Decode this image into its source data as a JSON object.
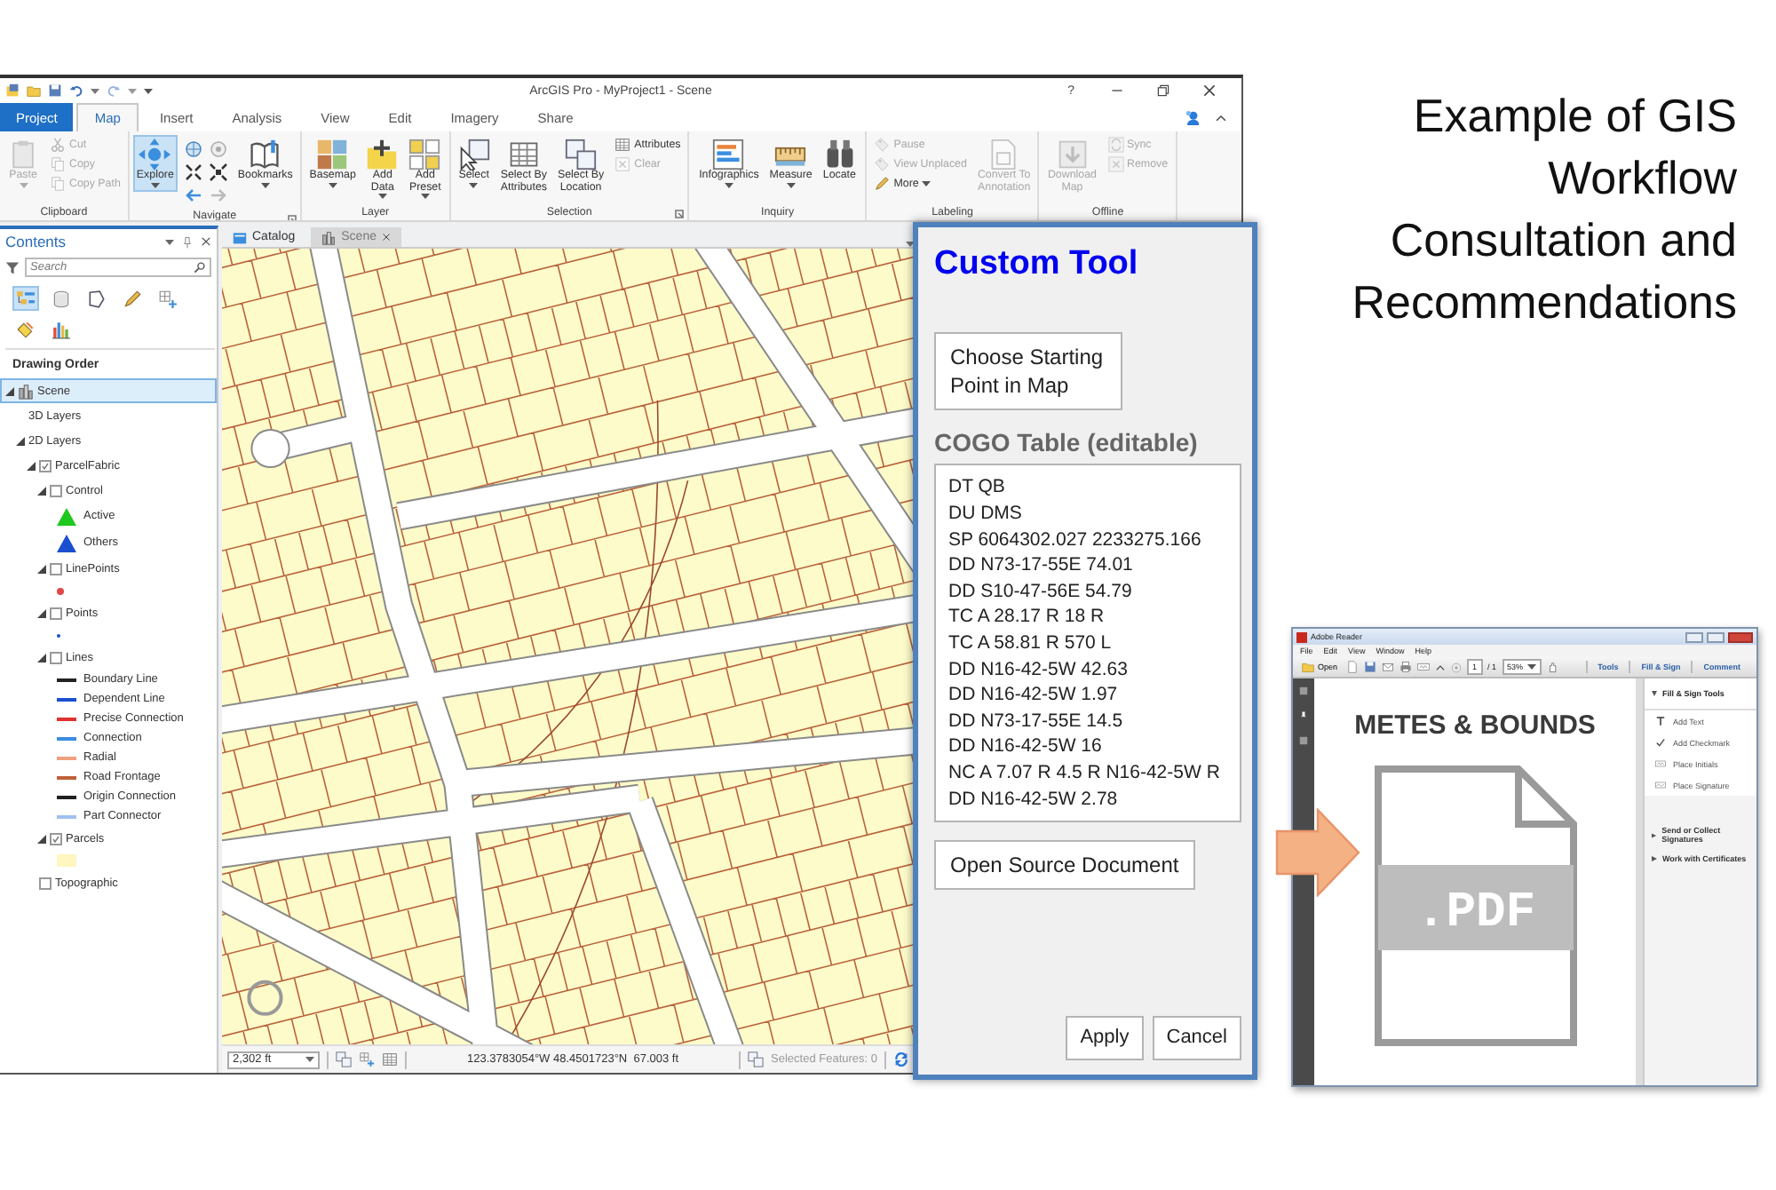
{
  "slide": {
    "title": "Example of GIS Workflow Consultation and Recommendations"
  },
  "arcgis": {
    "title": "ArcGIS Pro - MyProject1 - Scene",
    "help": "?",
    "tabs": [
      {
        "label": "Project",
        "kind": "backstage",
        "selected": false
      },
      {
        "label": "Map",
        "kind": "tab",
        "selected": true
      },
      {
        "label": "Insert",
        "kind": "tab",
        "selected": false
      },
      {
        "label": "Analysis",
        "kind": "tab",
        "selected": false
      },
      {
        "label": "View",
        "kind": "tab",
        "selected": false
      },
      {
        "label": "Edit",
        "kind": "tab",
        "selected": false
      },
      {
        "label": "Imagery",
        "kind": "tab",
        "selected": false
      },
      {
        "label": "Share",
        "kind": "tab",
        "selected": false
      }
    ],
    "ribbon": [
      {
        "label": "Clipboard",
        "items": [
          {
            "kind": "large",
            "label": "Paste",
            "disabled": true,
            "active": false,
            "dropdown": true
          },
          {
            "kind": "stack",
            "items": [
              {
                "label": "Cut",
                "disabled": true,
                "dropdown": false
              },
              {
                "label": "Copy",
                "disabled": true,
                "dropdown": false
              },
              {
                "label": "Copy Path",
                "disabled": true,
                "dropdown": false
              }
            ]
          }
        ]
      },
      {
        "label": "Navigate",
        "launcher": true,
        "items": [
          {
            "kind": "large",
            "label": "Explore",
            "disabled": false,
            "active": true,
            "dropdown": true
          },
          {
            "kind": "nav-grid"
          },
          {
            "kind": "large",
            "label": "Bookmarks",
            "disabled": false,
            "active": false,
            "dropdown": true
          }
        ]
      },
      {
        "label": "Layer",
        "items": [
          {
            "kind": "large",
            "label": "Basemap",
            "disabled": false,
            "active": false,
            "dropdown": true
          },
          {
            "kind": "large",
            "label": "Add\nData",
            "disabled": false,
            "active": false,
            "dropdown": true
          },
          {
            "kind": "large",
            "label": "Add\nPreset",
            "disabled": false,
            "active": false,
            "dropdown": true
          }
        ]
      },
      {
        "label": "Selection",
        "launcher": true,
        "items": [
          {
            "kind": "large",
            "label": "Select",
            "disabled": false,
            "active": false,
            "dropdown": true
          },
          {
            "kind": "large",
            "label": "Select By\nAttributes",
            "disabled": false,
            "active": false,
            "dropdown": false
          },
          {
            "kind": "large",
            "label": "Select By\nLocation",
            "disabled": false,
            "active": false,
            "dropdown": false
          },
          {
            "kind": "stack",
            "items": [
              {
                "label": "Attributes",
                "disabled": false,
                "dropdown": false
              },
              {
                "label": "Clear",
                "disabled": true,
                "dropdown": false
              }
            ]
          }
        ]
      },
      {
        "label": "Inquiry",
        "items": [
          {
            "kind": "large",
            "label": "Infographics",
            "disabled": false,
            "active": false,
            "dropdown": true
          },
          {
            "kind": "large",
            "label": "Measure",
            "disabled": false,
            "active": false,
            "dropdown": true
          },
          {
            "kind": "large",
            "label": "Locate",
            "disabled": false,
            "active": false,
            "dropdown": false
          }
        ]
      },
      {
        "label": "Labeling",
        "items": [
          {
            "kind": "stack",
            "items": [
              {
                "label": "Pause",
                "disabled": true,
                "dropdown": false
              },
              {
                "label": "View Unplaced",
                "disabled": true,
                "dropdown": false
              },
              {
                "label": "More",
                "disabled": false,
                "dropdown": true
              }
            ]
          },
          {
            "kind": "large",
            "label": "Convert To\nAnnotation",
            "disabled": true,
            "active": false,
            "dropdown": false
          }
        ]
      },
      {
        "label": "Offline",
        "items": [
          {
            "kind": "large",
            "label": "Download\nMap",
            "disabled": true,
            "active": false,
            "dropdown": false
          },
          {
            "kind": "stack",
            "items": [
              {
                "label": "Sync",
                "disabled": true,
                "dropdown": false
              },
              {
                "label": "Remove",
                "disabled": true,
                "dropdown": false
              }
            ]
          }
        ]
      }
    ],
    "contents": {
      "title": "Contents",
      "search_placeholder": "Search",
      "view_buttons": [
        {
          "selected": true
        },
        {
          "selected": false
        },
        {
          "selected": false
        },
        {
          "selected": false
        },
        {
          "selected": false
        },
        {
          "selected": false
        },
        {
          "selected": false
        }
      ],
      "heading": "Drawing Order",
      "tree": [
        {
          "kind": "map",
          "label": "Scene",
          "expanded": true,
          "selected": true,
          "children": [
            {
              "kind": "group",
              "label": "3D Layers",
              "selected": false
            },
            {
              "kind": "group",
              "label": "2D Layers",
              "expanded": true,
              "selected": false,
              "children": [
                {
                  "kind": "layer",
                  "label": "ParcelFabric",
                  "checked": true,
                  "expanded": true,
                  "selected": false,
                  "children": [
                    {
                      "kind": "layer",
                      "label": "Control",
                      "checked": false,
                      "expanded": true,
                      "selected": false,
                      "children": [
                        {
                          "kind": "triangle",
                          "color": "#1ec81e",
                          "label": "Active"
                        },
                        {
                          "kind": "triangle",
                          "color": "#1a4fd0",
                          "label": "Others"
                        }
                      ]
                    },
                    {
                      "kind": "layer",
                      "label": "LinePoints",
                      "checked": false,
                      "expanded": true,
                      "selected": false,
                      "children": [
                        {
                          "kind": "dot",
                          "color": "#e04848"
                        }
                      ]
                    },
                    {
                      "kind": "layer",
                      "label": "Points",
                      "checked": false,
                      "expanded": true,
                      "selected": false,
                      "children": [
                        {
                          "kind": "small-dot",
                          "color": "#1a4fd0"
                        }
                      ]
                    },
                    {
                      "kind": "layer",
                      "label": "Lines",
                      "checked": false,
                      "expanded": true,
                      "selected": false,
                      "children": [
                        {
                          "kind": "line",
                          "color": "#222222",
                          "label": "Boundary Line"
                        },
                        {
                          "kind": "line",
                          "color": "#1a4fd0",
                          "label": "Dependent Line"
                        },
                        {
                          "kind": "line",
                          "color": "#e03030",
                          "label": "Precise Connection"
                        },
                        {
                          "kind": "line",
                          "color": "#3a8ee0",
                          "label": "Connection"
                        },
                        {
                          "kind": "line",
                          "color": "#f0a080",
                          "label": "Radial"
                        },
                        {
                          "kind": "line",
                          "color": "#c0603a",
                          "label": "Road Frontage"
                        },
                        {
                          "kind": "line",
                          "color": "#202020",
                          "label": "Origin Connection"
                        },
                        {
                          "kind": "line",
                          "color": "#a0c0f0",
                          "label": "Part Connector"
                        }
                      ]
                    },
                    {
                      "kind": "layer",
                      "label": "Parcels",
                      "checked": true,
                      "expanded": true,
                      "selected": false,
                      "children": [
                        {
                          "kind": "patch",
                          "color": "#fff6c0"
                        }
                      ]
                    }
                  ]
                },
                {
                  "kind": "layer",
                  "label": "Topographic",
                  "checked": false,
                  "selected": false
                }
              ]
            }
          ]
        }
      ]
    },
    "map": {
      "tabs": [
        {
          "label": "Catalog",
          "selected": false,
          "closable": false
        },
        {
          "label": "Scene",
          "selected": true,
          "closable": true
        }
      ],
      "status": {
        "scale": "2,302 ft",
        "coordinates": "123.3783054°W 48.4501723°N  67.003 ft",
        "selection": "Selected Features: 0"
      }
    }
  },
  "custom_tool": {
    "title": "Custom Tool",
    "pick_button": "Choose Starting Point in Map",
    "table_label": "COGO Table (editable)",
    "table_lines": [
      "DT QB",
      "DU DMS",
      "SP 6064302.027 2233275.166",
      "DD N73-17-55E 74.01",
      "DD S10-47-56E 54.79",
      "TC A 28.17 R 18 R",
      "TC A 58.81 R 570 L",
      "DD N16-42-5W 42.63",
      "DD N16-42-5W 1.97",
      "DD N73-17-55E 14.5",
      "DD N16-42-5W 16",
      "NC A 7.07 R 4.5 R N16-42-5W R",
      "DD N16-42-5W 2.78"
    ],
    "source_button": "Open Source Document",
    "apply": "Apply",
    "cancel": "Cancel"
  },
  "pdf_viewer": {
    "title": "Adobe Reader",
    "menu": [
      "File",
      "Edit",
      "View",
      "Window",
      "Help"
    ],
    "open": "Open",
    "page": "1",
    "page_count": "/ 1",
    "zoom": "53%",
    "tabs": [
      "Tools",
      "Fill & Sign",
      "Comment"
    ],
    "panel": {
      "heading": "Fill & Sign Tools",
      "tools": [
        "Add Text",
        "Add Checkmark",
        "Place Initials",
        "Place Signature"
      ],
      "sections": [
        "Send or Collect Signatures",
        "Work with Certificates"
      ]
    },
    "document": {
      "heading": "METES & BOUNDS",
      "file_label": ".PDF"
    }
  }
}
